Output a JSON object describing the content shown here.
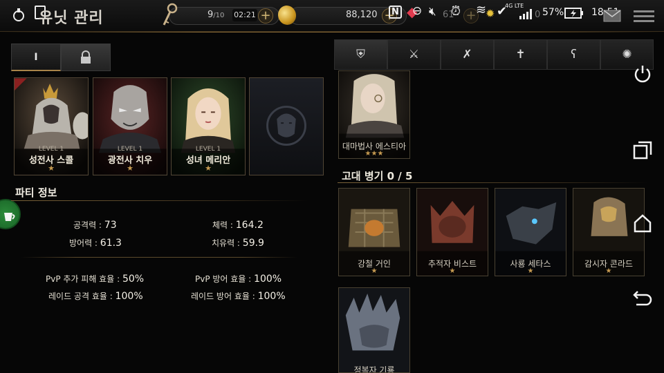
{
  "header": {
    "title": "유닛 관리",
    "stamina": {
      "current": "9",
      "max": "/10",
      "timer": "02:21"
    },
    "gold": "88,120",
    "plus_label": "+"
  },
  "status_bar": {
    "battery": "57%",
    "time": "18:51",
    "network": "4G LTE",
    "ghost_num1": "61",
    "ghost_num2": "0"
  },
  "left_tabs": [
    {
      "label": "I"
    },
    {
      "icon": "lock-icon"
    }
  ],
  "party": [
    {
      "level": "LEVEL 1",
      "name": "성전사 스콜",
      "stars": "★"
    },
    {
      "level": "LEVEL 1",
      "name": "광전사 치우",
      "stars": "★"
    },
    {
      "level": "LEVEL 1",
      "name": "성녀 메리안",
      "stars": "★"
    },
    {
      "level": "",
      "name": "",
      "stars": ""
    }
  ],
  "party_info": {
    "title": "파티 정보",
    "attack": {
      "label": "공격력 : ",
      "value": "73"
    },
    "hp": {
      "label": "체력 : ",
      "value": "164.2"
    },
    "defense": {
      "label": "방어력 : ",
      "value": "61.3"
    },
    "heal": {
      "label": "치유력 : ",
      "value": "59.9"
    },
    "pvp_dmg": {
      "label": "PvP 추가 피해 효율 : ",
      "value": "50%"
    },
    "pvp_def": {
      "label": "PvP 방어 효율 : ",
      "value": "100%"
    },
    "raid_atk": {
      "label": "레이드 공격 효율 : ",
      "value": "100%"
    },
    "raid_def": {
      "label": "레이드 방어 효율 : ",
      "value": "100%"
    }
  },
  "class_tabs": [
    "shield-icon",
    "crossed-swords-icon",
    "bow-icon",
    "cross-icon",
    "staff-icon",
    "beast-icon"
  ],
  "heroes": [
    {
      "name": "대마법사 에스티아",
      "stars": "★★★"
    }
  ],
  "ancient": {
    "title": "고대 병기 0 / 5",
    "units": [
      {
        "name": "강철 거인",
        "stars": "★"
      },
      {
        "name": "추적자 비스트",
        "stars": "★"
      },
      {
        "name": "사룡 세타스",
        "stars": "★"
      },
      {
        "name": "감시자 콘라드",
        "stars": "★"
      },
      {
        "name": "정복자 기룡",
        "stars": ""
      }
    ]
  }
}
